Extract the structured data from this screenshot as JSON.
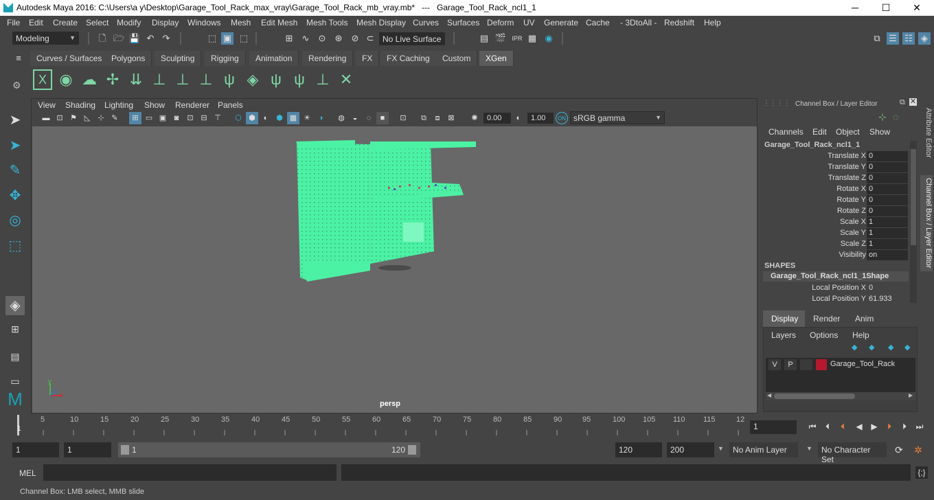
{
  "title": "Autodesk Maya 2016: C:\\Users\\a y\\Desktop\\Garage_Tool_Rack_max_vray\\Garage_Tool_Rack_mb_vray.mb*   ---   Garage_Tool_Rack_ncl1_1",
  "window_buttons": {
    "minimize": "─",
    "maximize": "☐",
    "close": "✕"
  },
  "menus": [
    "File",
    "Edit",
    "Create",
    "Select",
    "Modify",
    "Display",
    "Windows",
    "Mesh",
    "Edit Mesh",
    "Mesh Tools",
    "Mesh Display",
    "Curves",
    "Surfaces",
    "Deform",
    "UV",
    "Generate",
    "Cache",
    "- 3DtoAll -",
    "Redshift",
    "Help"
  ],
  "mode_dropdown": "Modeling",
  "live_surface": "No Live Surface",
  "shelf_tabs": [
    "Curves / Surfaces",
    "Polygons",
    "Sculpting",
    "Rigging",
    "Animation",
    "Rendering",
    "FX",
    "FX Caching",
    "Custom",
    "XGen"
  ],
  "active_shelf_tab": "XGen",
  "viewport": {
    "menus": [
      "View",
      "Shading",
      "Lighting",
      "Show",
      "Renderer",
      "Panels"
    ],
    "exposure": "0.00",
    "gamma": "1.00",
    "color_space": "sRGB gamma",
    "camera": "persp",
    "axis_x": "x",
    "axis_y": "y",
    "axis_z": "z"
  },
  "channel_box": {
    "header": "Channel Box / Layer Editor",
    "menus": [
      "Channels",
      "Edit",
      "Object",
      "Show"
    ],
    "object": "Garage_Tool_Rack_ncl1_1",
    "attributes": [
      {
        "name": "Translate X",
        "value": "0"
      },
      {
        "name": "Translate Y",
        "value": "0"
      },
      {
        "name": "Translate Z",
        "value": "0"
      },
      {
        "name": "Rotate X",
        "value": "0"
      },
      {
        "name": "Rotate Y",
        "value": "0"
      },
      {
        "name": "Rotate Z",
        "value": "0"
      },
      {
        "name": "Scale X",
        "value": "1"
      },
      {
        "name": "Scale Y",
        "value": "1"
      },
      {
        "name": "Scale Z",
        "value": "1"
      },
      {
        "name": "Visibility",
        "value": "on"
      }
    ],
    "shapes_label": "SHAPES",
    "shape_name": "Garage_Tool_Rack_ncl1_1Shape",
    "shape_attributes": [
      {
        "name": "Local Position X",
        "value": "0"
      },
      {
        "name": "Local Position Y",
        "value": "61.933"
      }
    ]
  },
  "side_tabs": [
    "Attribute Editor",
    "Channel Box / Layer Editor"
  ],
  "layer_editor": {
    "tabs": [
      "Display",
      "Render",
      "Anim"
    ],
    "active_tab": "Display",
    "menus": [
      "Layers",
      "Options",
      "Help"
    ],
    "layer": {
      "v": "V",
      "p": "P",
      "name": "Garage_Tool_Rack",
      "color": "#b5182f"
    }
  },
  "timeline": {
    "ticks": [
      "5",
      "10",
      "15",
      "20",
      "25",
      "30",
      "35",
      "40",
      "45",
      "50",
      "55",
      "60",
      "65",
      "70",
      "75",
      "80",
      "85",
      "90",
      "95",
      "100",
      "105",
      "110",
      "115",
      "12"
    ],
    "current_marker": "1",
    "current_frame": "1"
  },
  "range": {
    "start": "1",
    "playback_start": "1",
    "slider_start": "1",
    "slider_end": "120",
    "playback_end": "120",
    "end": "200",
    "anim_layer": "No Anim Layer",
    "character_set": "No Character Set"
  },
  "mel_label": "MEL",
  "help_line": "Channel Box: LMB select, MMB slide",
  "colors": {
    "model": "#4cf2a4",
    "accent": "#5285a6",
    "bg": "#444444",
    "viewport": "#686868"
  }
}
